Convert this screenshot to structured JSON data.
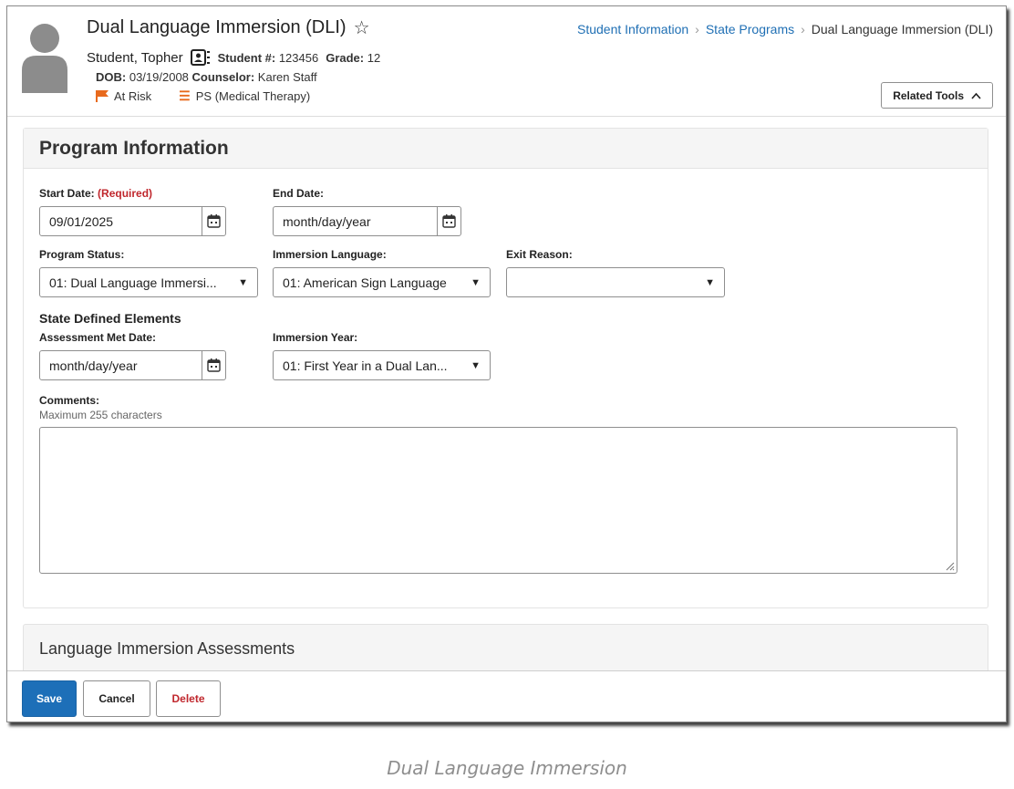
{
  "header": {
    "title": "Dual Language Immersion (DLI)",
    "breadcrumb": [
      "Student Information",
      "State Programs",
      "Dual Language Immersion (DLI)"
    ],
    "student": {
      "name": "Student, Topher",
      "student_number_label": "Student #:",
      "student_number": "123456",
      "grade_label": "Grade:",
      "grade": "12",
      "dob_label": "DOB:",
      "dob": "03/19/2008",
      "counselor_label": "Counselor:",
      "counselor": "Karen Staff",
      "flags": [
        "At Risk",
        "PS (Medical Therapy)"
      ]
    },
    "related_tools_label": "Related Tools"
  },
  "program_information": {
    "title": "Program Information",
    "start_date": {
      "label": "Start Date:",
      "required": "(Required)",
      "value": "09/01/2025"
    },
    "end_date": {
      "label": "End Date:",
      "placeholder": "month/day/year"
    },
    "program_status": {
      "label": "Program Status:",
      "value": "01: Dual Language Immersi..."
    },
    "immersion_language": {
      "label": "Immersion Language:",
      "value": "01: American Sign Language"
    },
    "exit_reason": {
      "label": "Exit Reason:",
      "value": ""
    },
    "state_defined_elements": "State Defined Elements",
    "assessment_met_date": {
      "label": "Assessment Met Date:",
      "placeholder": "month/day/year"
    },
    "immersion_year": {
      "label": "Immersion Year:",
      "value": "01: First Year in a Dual Lan..."
    },
    "comments": {
      "label": "Comments:",
      "hint": "Maximum 255 characters",
      "value": ""
    }
  },
  "language_immersion_assessments": {
    "title": "Language Immersion Assessments"
  },
  "footer": {
    "save": "Save",
    "cancel": "Cancel",
    "delete": "Delete"
  },
  "caption": "Dual Language Immersion",
  "colors": {
    "link": "#1f6fb4",
    "primary": "#1d6fb8",
    "danger": "#c0272d",
    "flag": "#e86a1d"
  }
}
